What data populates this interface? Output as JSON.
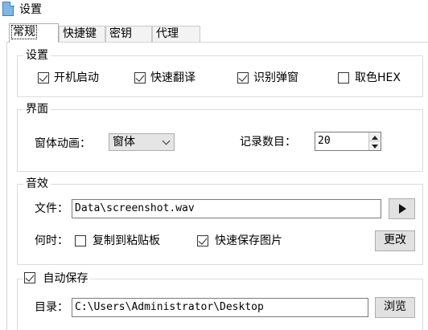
{
  "window": {
    "title": "设置"
  },
  "tabs": [
    {
      "label": "常规",
      "active": true
    },
    {
      "label": "快捷键",
      "active": false
    },
    {
      "label": "密钥",
      "active": false
    },
    {
      "label": "代理",
      "active": false
    }
  ],
  "settings_group": {
    "title": "设置",
    "options": [
      {
        "label": "开机启动",
        "checked": true
      },
      {
        "label": "快速翻译",
        "checked": true
      },
      {
        "label": "识别弹窗",
        "checked": true
      },
      {
        "label": "取色HEX",
        "checked": false
      }
    ]
  },
  "interface_group": {
    "title": "界面",
    "animation_label": "窗体动画：",
    "animation_value": "窗体",
    "record_label": "记录数目：",
    "record_value": "20"
  },
  "sound_group": {
    "title": "音效",
    "file_label": "文件：",
    "file_value": "Data\\screenshot.wav",
    "when_label": "何时：",
    "copy_option": {
      "label": "复制到粘贴板",
      "checked": false
    },
    "save_option": {
      "label": "快速保存图片",
      "checked": true
    },
    "change_button": "更改"
  },
  "autosave_group": {
    "title": "自动保存",
    "checked": true,
    "dir_label": "目录：",
    "dir_value": "C:\\Users\\Administrator\\Desktop",
    "browse_button": "浏览"
  },
  "icons": {
    "app": "settings-app-icon",
    "play": "play-icon",
    "dropdown": "chevron-down-icon",
    "spin_up": "spin-up-icon",
    "spin_down": "spin-down-icon"
  }
}
